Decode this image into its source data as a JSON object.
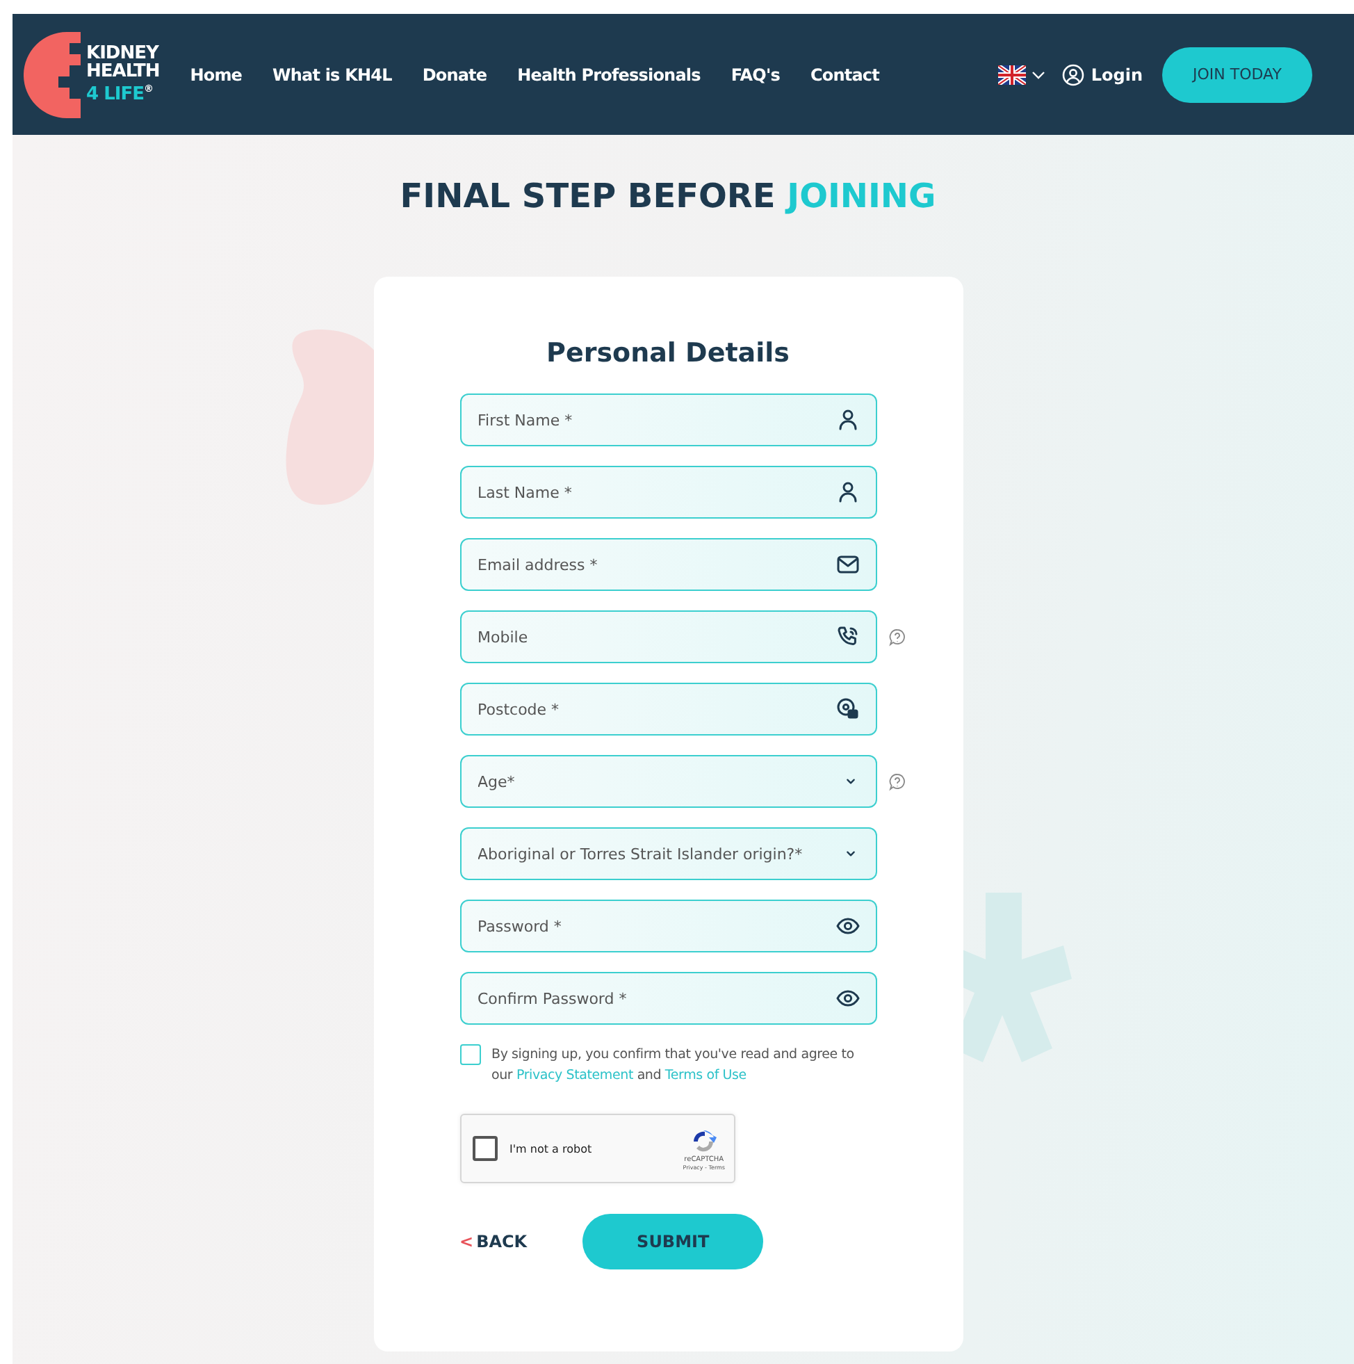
{
  "header": {
    "logo_lines": [
      "KIDNEY",
      "HEALTH",
      "4 LIFE$^{®}$"
    ],
    "nav": [
      {
        "label": "Home"
      },
      {
        "label": "What is KH4L"
      },
      {
        "label": "Donate"
      },
      {
        "label": "Health Professionals"
      },
      {
        "label": "FAQ's"
      },
      {
        "label": "Contact"
      }
    ],
    "login": "Login",
    "join": "JOIN TODAY"
  },
  "heading": {
    "text": "FINAL STEP BEFORE",
    "highlight": "JOINING"
  },
  "form": {
    "title": "Personal Details",
    "fields": [
      {
        "kind": "person",
        "placeholder": "First Name *",
        "help": false
      },
      {
        "kind": "person",
        "placeholder": "Last Name *",
        "help": false
      },
      {
        "kind": "email",
        "placeholder": "Email address *",
        "help": false
      },
      {
        "kind": "phone",
        "placeholder": "Mobile",
        "help": true
      },
      {
        "kind": "postcode",
        "placeholder": "Postcode *",
        "help": false
      },
      {
        "kind": "select",
        "placeholder": "Age*",
        "help": true
      },
      {
        "kind": "select",
        "placeholder": "Aboriginal or Torres Strait Islander origin?*",
        "help": false
      },
      {
        "kind": "password",
        "placeholder": "Password *",
        "help": false
      },
      {
        "kind": "password",
        "placeholder": "Confirm Password *",
        "help": false
      }
    ],
    "terms": {
      "checked": false,
      "text": "By signing up, you confirm that you've read and agree to our",
      "link1": "Privacy Statement",
      "joiner": "and",
      "link2": "Terms of Use"
    },
    "captcha": {
      "checked": false,
      "label": "I'm not a robot",
      "brand": "reCAPTCHA",
      "links": "Privacy - Terms"
    },
    "back": {
      "arrow": "<",
      "label": "BACK"
    },
    "submit": "SUBMIT"
  }
}
